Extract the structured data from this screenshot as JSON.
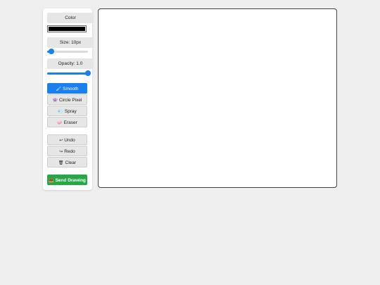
{
  "toolbar": {
    "color_label": "Color",
    "color_value": "#000000",
    "size_label": "Size: 10px",
    "size_value_fraction": 0.1,
    "opacity_label": "Opacity: 1.0",
    "opacity_value_fraction": 1.0
  },
  "brushes": [
    {
      "label": "Smooth",
      "icon": "brush-icon",
      "glyph": "🖌",
      "active": true
    },
    {
      "label": "Circle Pixel",
      "icon": "alien-icon",
      "glyph": "👾",
      "active": false
    },
    {
      "label": "Spray",
      "icon": "spray-icon",
      "glyph": "💨",
      "active": false
    },
    {
      "label": "Eraser",
      "icon": "eraser-icon",
      "glyph": "🧼",
      "active": false
    }
  ],
  "actions": [
    {
      "label": "Undo",
      "icon": "undo-icon",
      "glyph": "↩"
    },
    {
      "label": "Redo",
      "icon": "redo-icon",
      "glyph": "↪"
    },
    {
      "label": "Clear",
      "icon": "trash-icon",
      "glyph": "🗑"
    }
  ],
  "send": {
    "label": "Send Drawing",
    "icon": "send-icon",
    "glyph": "📤"
  },
  "colors": {
    "accent": "#1a7ff0",
    "send": "#28a745",
    "background": "#efefef"
  }
}
